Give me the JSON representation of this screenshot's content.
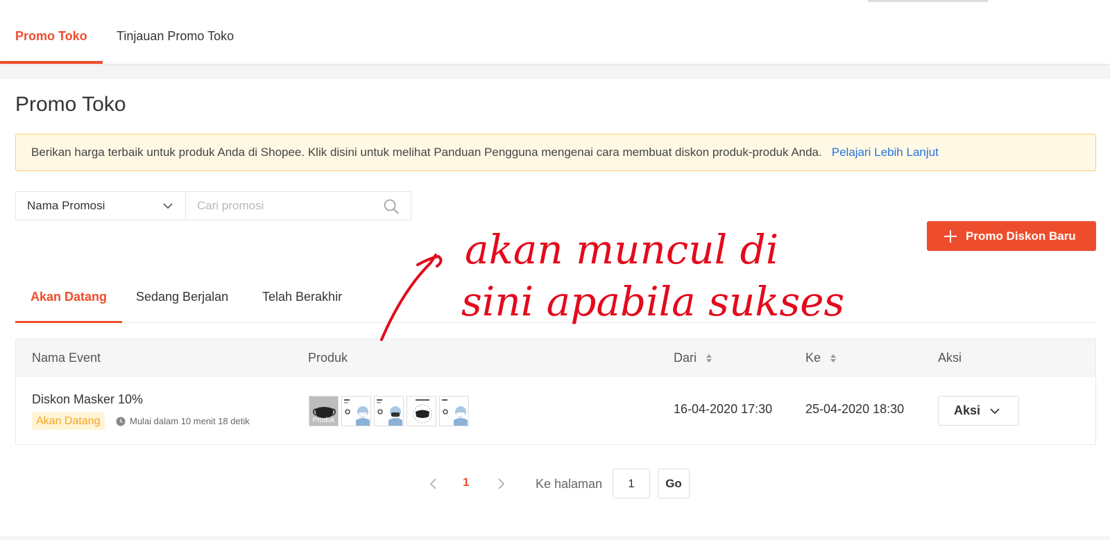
{
  "nav_tabs": [
    {
      "label": "Promo Toko",
      "active": true
    },
    {
      "label": "Tinjauan Promo Toko",
      "active": false
    }
  ],
  "page_title": "Promo Toko",
  "notice": {
    "text": "Berikan harga terbaik untuk produk Anda di Shopee. Klik disini untuk melihat Panduan Pengguna mengenai cara membuat diskon produk-produk Anda.",
    "link": "Pelajari Lebih Lanjut",
    "link_color": "#2673dd"
  },
  "filter": {
    "selected": "Nama Promosi",
    "search_placeholder": "Cari promosi",
    "search_value": ""
  },
  "new_button": {
    "label": "Promo Diskon Baru",
    "icon": "plus-icon"
  },
  "status_tabs": [
    {
      "label": "Akan Datang",
      "active": true
    },
    {
      "label": "Sedang Berjalan",
      "active": false
    },
    {
      "label": "Telah Berakhir",
      "active": false
    }
  ],
  "table": {
    "headers": {
      "event": "Nama Event",
      "products": "Produk",
      "from": "Dari",
      "to": "Ke",
      "action": "Aksi"
    },
    "rows": [
      {
        "name": "Diskon Masker 10%",
        "status": "Akan Datang",
        "countdown": "Mulai dalam 10 menit 18 detik",
        "thumb_label": "Produk",
        "from": "16-04-2020 17:30",
        "to": "25-04-2020 18:30",
        "action_label": "Aksi"
      }
    ]
  },
  "pagination": {
    "current_page": "1",
    "goto_label": "Ke halaman",
    "goto_value": "1",
    "go_label": "Go"
  },
  "annotation": {
    "line1": "akan muncul di",
    "line2": "sini apabila sukses",
    "color": "#e30a1c"
  },
  "colors": {
    "accent": "#ee4d2d",
    "warning_bg": "#fff8e4",
    "badge_text": "#f5a623"
  }
}
